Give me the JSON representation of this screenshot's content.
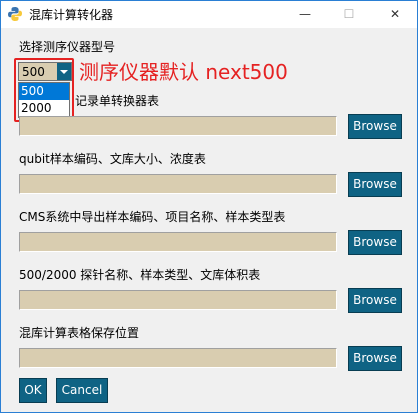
{
  "window": {
    "title": "混库计算转化器",
    "minimize_glyph": "—",
    "maximize_glyph": "☐",
    "close_glyph": "✕"
  },
  "form": {
    "model_label": "选择测序仪器型号",
    "model_selected": "500",
    "model_options": [
      "500",
      "2000"
    ],
    "annotation": "测序仪器默认 next500",
    "fields": [
      {
        "label": "记录单转换器表",
        "value": "",
        "button": "Browse"
      },
      {
        "label": "qubit样本编码、文库大小、浓度表",
        "value": "",
        "button": "Browse"
      },
      {
        "label": "CMS系统中导出样本编码、项目名称、样本类型表",
        "value": "",
        "button": "Browse"
      },
      {
        "label": "500/2000 探针名称、样本类型、文库体积表",
        "value": "",
        "button": "Browse"
      },
      {
        "label": "混库计算表格保存位置",
        "value": "",
        "button": "Browse"
      }
    ],
    "ok_label": "OK",
    "cancel_label": "Cancel"
  },
  "colors": {
    "accent": "#0f6384",
    "field_bg": "#d9cdb0",
    "annotation": "#e52222",
    "selection": "#0078d7"
  },
  "icons": {
    "app": "python-logo-icon"
  }
}
